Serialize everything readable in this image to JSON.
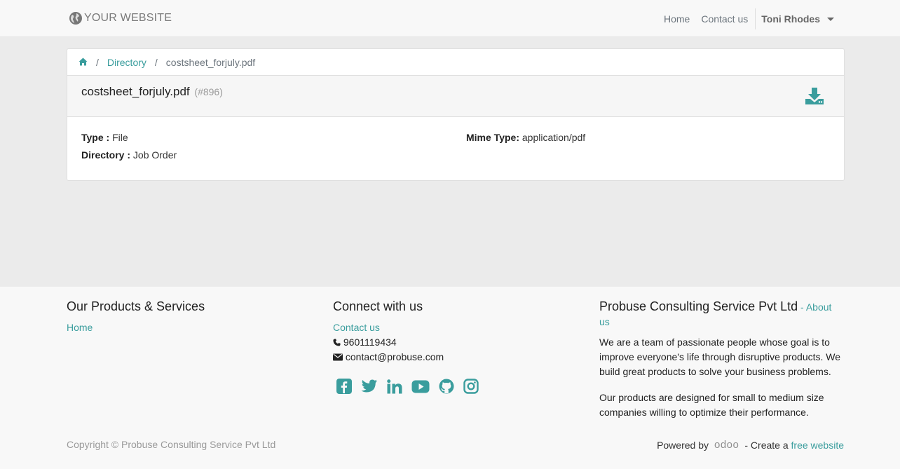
{
  "navbar": {
    "logo_text": "YOUR WEBSITE",
    "links": [
      "Home",
      "Contact us"
    ],
    "user": "Toni Rhodes"
  },
  "breadcrumb": {
    "home_icon": "home-icon",
    "directory": "Directory",
    "current": "costsheet_forjuly.pdf"
  },
  "file": {
    "name": "costsheet_forjuly.pdf",
    "id": "(#896)",
    "type_label": "Type :",
    "type_value": "File",
    "directory_label": "Directory :",
    "directory_value": "Job Order",
    "mime_label": "Mime Type:",
    "mime_value": "application/pdf",
    "download_icon": "download-icon"
  },
  "footer": {
    "products_title": "Our Products & Services",
    "products_link": "Home",
    "connect_title": "Connect with us",
    "contact_link": "Contact us",
    "phone": "9601119434",
    "email": "contact@probuse.com",
    "social_icons": [
      "facebook-icon",
      "twitter-icon",
      "linkedin-icon",
      "youtube-icon",
      "github-icon",
      "instagram-icon"
    ],
    "company_title": "Probuse Consulting Service Pvt Ltd",
    "company_dash": " - ",
    "about_link": "About us",
    "about_p1": "We are a team of passionate people whose goal is to improve everyone's life through disruptive products. We build great products to solve your business problems.",
    "about_p2": "Our products are designed for small to medium size companies willing to optimize their performance.",
    "copyright": "Copyright © Probuse Consulting Service Pvt Ltd",
    "powered_by": "Powered by",
    "odoo": "odoo",
    "create_text": "- Create a",
    "free_website": "free website"
  },
  "colors": {
    "accent": "#3a9d9d",
    "navbar_bg": "#f8f8f8",
    "page_bg": "#ebebeb"
  }
}
